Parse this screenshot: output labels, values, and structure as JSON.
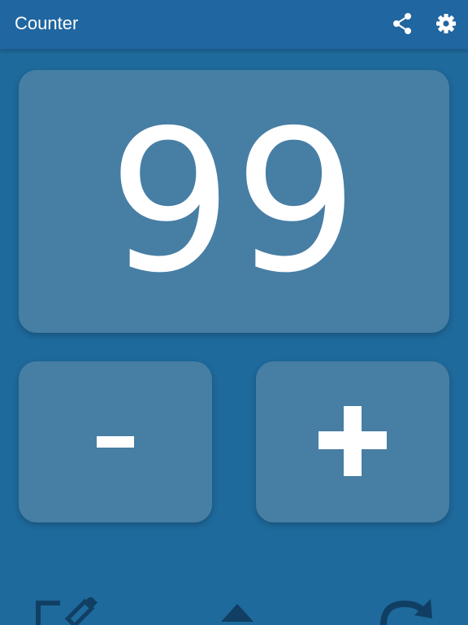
{
  "appbar": {
    "title": "Counter",
    "share_icon": "share-icon",
    "settings_icon": "gear-icon"
  },
  "counter": {
    "value": "99",
    "decrement_label": "-",
    "increment_label": "+"
  },
  "bottom_bar": {
    "edit_icon": "pencil-edit-icon",
    "expand_icon": "chevron-up-icon",
    "reset_icon": "redo-icon"
  },
  "colors": {
    "background": "#1e6a9c",
    "appbar": "#2066a0",
    "card": "#477ea4",
    "text": "#ffffff",
    "bottom_icons": "#103f63"
  }
}
